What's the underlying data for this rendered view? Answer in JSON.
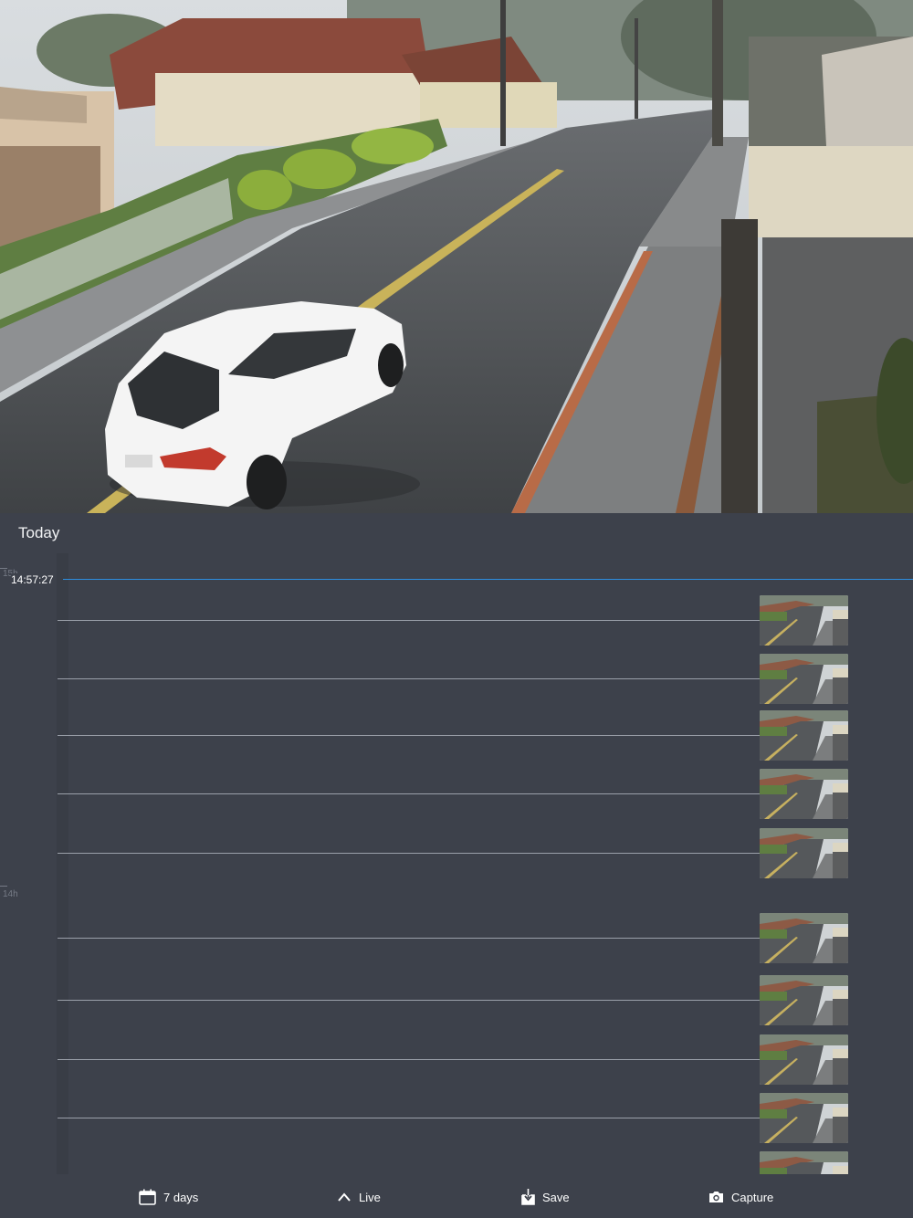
{
  "camera": {
    "snapshot_alt": "street camera view"
  },
  "timeline": {
    "day_label": "Today",
    "current_time": "14:57:27",
    "hour_labels": [
      "15h",
      "14h"
    ],
    "event_count": 10
  },
  "toolbar": {
    "days_label": "7 days",
    "live_label": "Live",
    "save_label": "Save",
    "capture_label": "Capture",
    "icons": {
      "days": "calendar-icon",
      "live": "chevron-up-icon",
      "save": "download-icon",
      "capture": "camera-icon"
    }
  },
  "colors": {
    "background": "#3d414b",
    "now_line": "#2d8ee0",
    "event_line": "#9ba0aa"
  }
}
